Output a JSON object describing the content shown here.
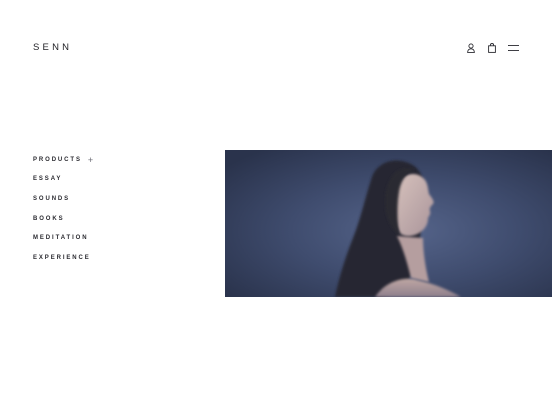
{
  "header": {
    "logo": "SENN",
    "icons": [
      "user-icon",
      "bag-icon",
      "menu-icon"
    ]
  },
  "nav": {
    "items": [
      {
        "label": "PRODUCTS",
        "expand": "+"
      },
      {
        "label": "ESSAY"
      },
      {
        "label": "SOUNDS"
      },
      {
        "label": "BOOKS"
      },
      {
        "label": "MEDITATION"
      },
      {
        "label": "EXPERIENCE"
      }
    ]
  },
  "hero": {
    "subject": "portrait-photo",
    "colors": {
      "background": "#3b4868",
      "skin": "#c9b2ab",
      "hair": "#26252b"
    }
  },
  "colors": {
    "text": "#1f1f24",
    "page_background": "#ffffff"
  }
}
